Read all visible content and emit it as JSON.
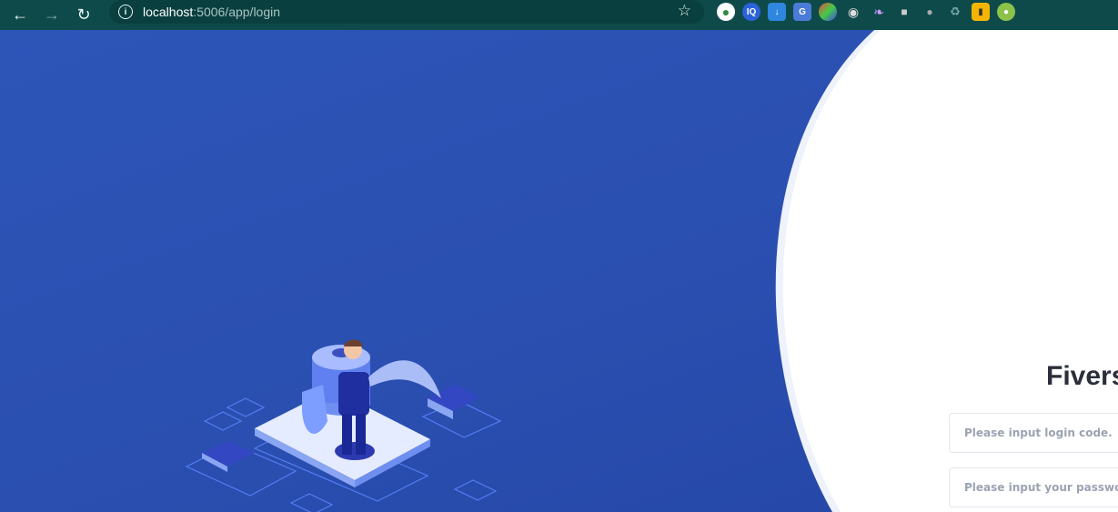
{
  "browser": {
    "url_host": "localhost",
    "url_rest": ":5006/app/login",
    "extensions": [
      "globe-extension",
      "iq-extension",
      "download-extension",
      "translate-extension",
      "color-extension",
      "camera-extension",
      "feather-extension",
      "shield-extension",
      "mic-extension",
      "recycle-extension",
      "battery-extension",
      "bulb-extension"
    ]
  },
  "login": {
    "title": "Fivers",
    "code_placeholder": "Please input login code.",
    "password_placeholder": "Please input your password."
  },
  "colors": {
    "toolbar": "#0f4a4a",
    "background": "#2a4fb0",
    "panel": "#ffffff"
  }
}
